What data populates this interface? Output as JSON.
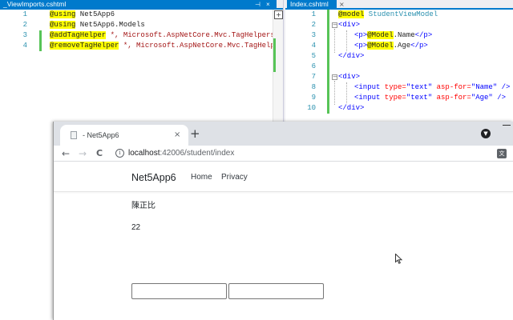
{
  "editor_left": {
    "tab_label": "_ViewImports.cshtml",
    "tab_pin": "⊣",
    "tab_close": "×",
    "split_glyph": "+",
    "lines": [
      {
        "num": "1",
        "kw": "@using",
        "rest": " Net5App6"
      },
      {
        "num": "2",
        "kw": "@using",
        "rest": " Net5App6.Models"
      },
      {
        "num": "3",
        "kw": "@addTagHelper",
        "rest": " *, Microsoft.AspNetCore.Mvc.TagHelpers"
      },
      {
        "num": "4",
        "kw": "@removeTagHelper",
        "rest": " *, Microsoft.AspNetCore.Mvc.TagHelpers"
      }
    ]
  },
  "editor_right": {
    "tab_label": "Index.cshtml",
    "tab_close": "×",
    "line_numbers": [
      "1",
      "2",
      "3",
      "4",
      "5",
      "6",
      "7",
      "8",
      "9",
      "10"
    ],
    "l1": {
      "kw": "@model",
      "type": " StudentViewModel"
    },
    "l2": {
      "tag": "<div>"
    },
    "l3": {
      "open": "<p>",
      "model": "@Model",
      "prop": ".Name",
      "close": "</p>"
    },
    "l4": {
      "open": "<p>",
      "model": "@Model",
      "prop": ".Age",
      "close": "</p>"
    },
    "l5": {
      "tag": "</div>"
    },
    "l7": {
      "tag": "<div>"
    },
    "l8": {
      "open": "<input",
      "attr1": " type=",
      "val1": "\"text\"",
      "attr2": " asp-for=",
      "val2": "\"Name\"",
      "close": " />"
    },
    "l9": {
      "open": "<input",
      "attr1": " type=",
      "val1": "\"text\"",
      "attr2": " asp-for=",
      "val2": "\"Age\"",
      "close": " />"
    },
    "l10": {
      "tag": "</div>"
    },
    "fold_glyph": "−"
  },
  "browser": {
    "tab_title": "- Net5App6",
    "tab_close": "×",
    "new_tab": "+",
    "profile_glyph": "▼",
    "back": "←",
    "forward": "→",
    "reload": "C",
    "info_glyph": "i",
    "url_host": "localhost",
    "url_rest": ":42006/student/index",
    "translate_glyph": "文"
  },
  "site": {
    "brand": "Net5App6",
    "nav": [
      "Home",
      "Privacy"
    ],
    "name_value": "陳正比",
    "age_value": "22",
    "input_name_value": "",
    "input_age_value": ""
  },
  "colors": {
    "vs_accent": "#007acc",
    "change_bar": "#57c457",
    "razor_highlight": "#ffff00"
  }
}
